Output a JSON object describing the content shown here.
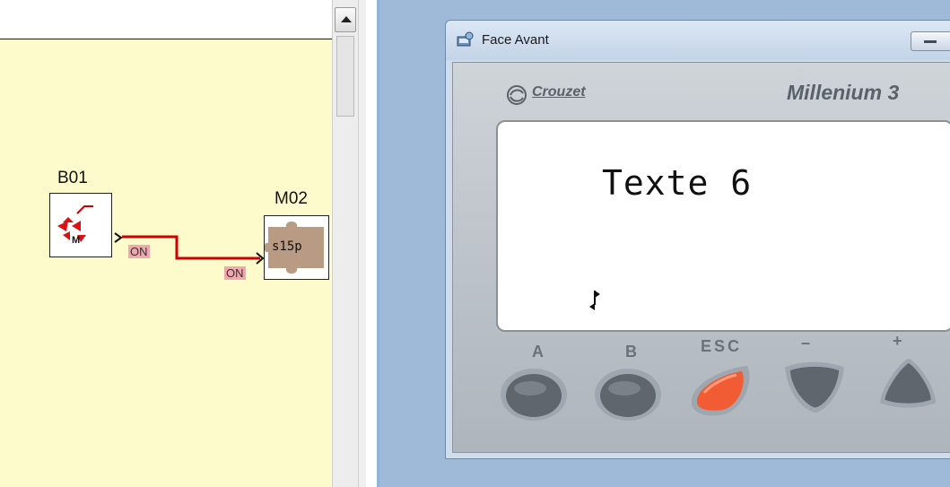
{
  "diagram": {
    "blocks": [
      {
        "id": "B01",
        "icon": "pulse-icon"
      },
      {
        "id": "M02",
        "text": "s15p"
      }
    ],
    "output_label": "ON",
    "input_label": "ON",
    "wire_color": "#cc0000",
    "background": "#fdfbcb"
  },
  "window": {
    "title": "Face Avant",
    "minimize_icon": "minimize-icon"
  },
  "device": {
    "brand": "Crouzet",
    "model": "Millenium 3",
    "display_text": "Texte 6",
    "keys": [
      {
        "label": "A",
        "color": "#5f666d"
      },
      {
        "label": "B",
        "color": "#5f666d"
      },
      {
        "label": "ESC",
        "color": "#f25c35"
      },
      {
        "label": "–",
        "color": "#5f666d"
      },
      {
        "label": "+",
        "color": "#5f666d"
      }
    ]
  }
}
